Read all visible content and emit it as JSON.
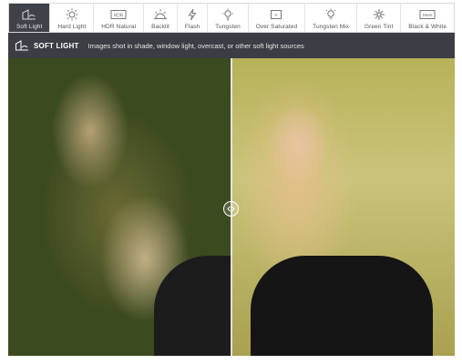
{
  "tabs": [
    {
      "label": "Soft Light",
      "icon": "soft-light-icon",
      "active": true
    },
    {
      "label": "Hard Light",
      "icon": "hard-light-icon",
      "active": false
    },
    {
      "label": "HDR Natural",
      "icon": "hdr-natural-icon",
      "active": false
    },
    {
      "label": "Backlit",
      "icon": "backlit-icon",
      "active": false
    },
    {
      "label": "Flash",
      "icon": "flash-icon",
      "active": false
    },
    {
      "label": "Tungsten",
      "icon": "tungsten-icon",
      "active": false
    },
    {
      "label": "Over Saturated",
      "icon": "over-saturated-icon",
      "active": false
    },
    {
      "label": "Tungsten Mix",
      "icon": "tungsten-mix-icon",
      "active": false
    },
    {
      "label": "Green Tint",
      "icon": "green-tint-icon",
      "active": false
    },
    {
      "label": "Black & White",
      "icon": "black-white-icon",
      "active": false
    }
  ],
  "banner": {
    "title": "SOFT LIGHT",
    "description": "Images shot in shade, window light, overcast, or other soft light sources",
    "icon": "soft-light-icon"
  },
  "comparison": {
    "before_label": "",
    "after_label": "",
    "split_fraction": 0.5
  },
  "colors": {
    "active_tab_bg": "#3f4248",
    "banner_bg": "#3b3e44",
    "tab_text": "#555555"
  }
}
